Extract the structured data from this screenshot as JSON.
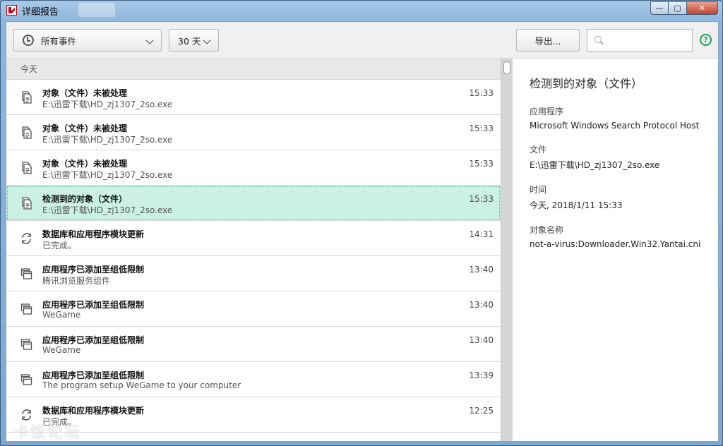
{
  "window": {
    "title": "详细报告",
    "controls": {
      "minimize": "—",
      "maximize": "▢",
      "close": "✕"
    }
  },
  "toolbar": {
    "filter_label": "所有事件",
    "days_label": "30 天",
    "export_label": "导出...",
    "search_placeholder": "",
    "help_symbol": "?"
  },
  "list": {
    "group_header": "今天",
    "events": [
      {
        "icon": "file-copy-icon",
        "title": "对象（文件）未被处理",
        "subtitle": "E:\\迅雷下载\\HD_zj1307_2so.exe",
        "time": "15:33",
        "selected": false
      },
      {
        "icon": "file-copy-icon",
        "title": "对象（文件）未被处理",
        "subtitle": "E:\\迅雷下载\\HD_zj1307_2so.exe",
        "time": "15:33",
        "selected": false
      },
      {
        "icon": "file-copy-icon",
        "title": "对象（文件）未被处理",
        "subtitle": "E:\\迅雷下载\\HD_zj1307_2so.exe",
        "time": "15:33",
        "selected": false
      },
      {
        "icon": "file-copy-icon",
        "title": "检测到的对象（文件）",
        "subtitle": "E:\\迅雷下载\\HD_zj1307_2so.exe",
        "time": "15:33",
        "selected": true
      },
      {
        "icon": "refresh-icon",
        "title": "数据库和应用程序模块更新",
        "subtitle": "已完成。",
        "time": "14:31",
        "selected": false
      },
      {
        "icon": "app-windows-icon",
        "title": "应用程序已添加至组低限制",
        "subtitle": "腾讯浏览服务组件",
        "time": "13:40",
        "selected": false
      },
      {
        "icon": "app-windows-icon",
        "title": "应用程序已添加至组低限制",
        "subtitle": "WeGame",
        "time": "13:40",
        "selected": false
      },
      {
        "icon": "app-windows-icon",
        "title": "应用程序已添加至组低限制",
        "subtitle": "WeGame",
        "time": "13:40",
        "selected": false
      },
      {
        "icon": "app-windows-icon",
        "title": "应用程序已添加至组低限制",
        "subtitle": "The program setup WeGame to your computer",
        "time": "13:39",
        "selected": false
      },
      {
        "icon": "refresh-icon",
        "title": "数据库和应用程序模块更新",
        "subtitle": "已完成。",
        "time": "12:25",
        "selected": false
      }
    ]
  },
  "detail": {
    "title": "检测到的对象（文件）",
    "fields": [
      {
        "label": "应用程序",
        "value": "Microsoft Windows Search Protocol Host"
      },
      {
        "label": "文件",
        "value": "E:\\迅雷下载\\HD_zj1307_2so.exe"
      },
      {
        "label": "时间",
        "value": "今天, 2018/1/11 15:33"
      },
      {
        "label": "对象名称",
        "value": "not-a-virus:Downloader.Win32.Yantai.cni"
      }
    ]
  },
  "watermark": "卡饭论坛",
  "colors": {
    "selected_row": "#cbf1e6",
    "help_green": "#1f9e52",
    "brand_red": "#c8001e"
  }
}
